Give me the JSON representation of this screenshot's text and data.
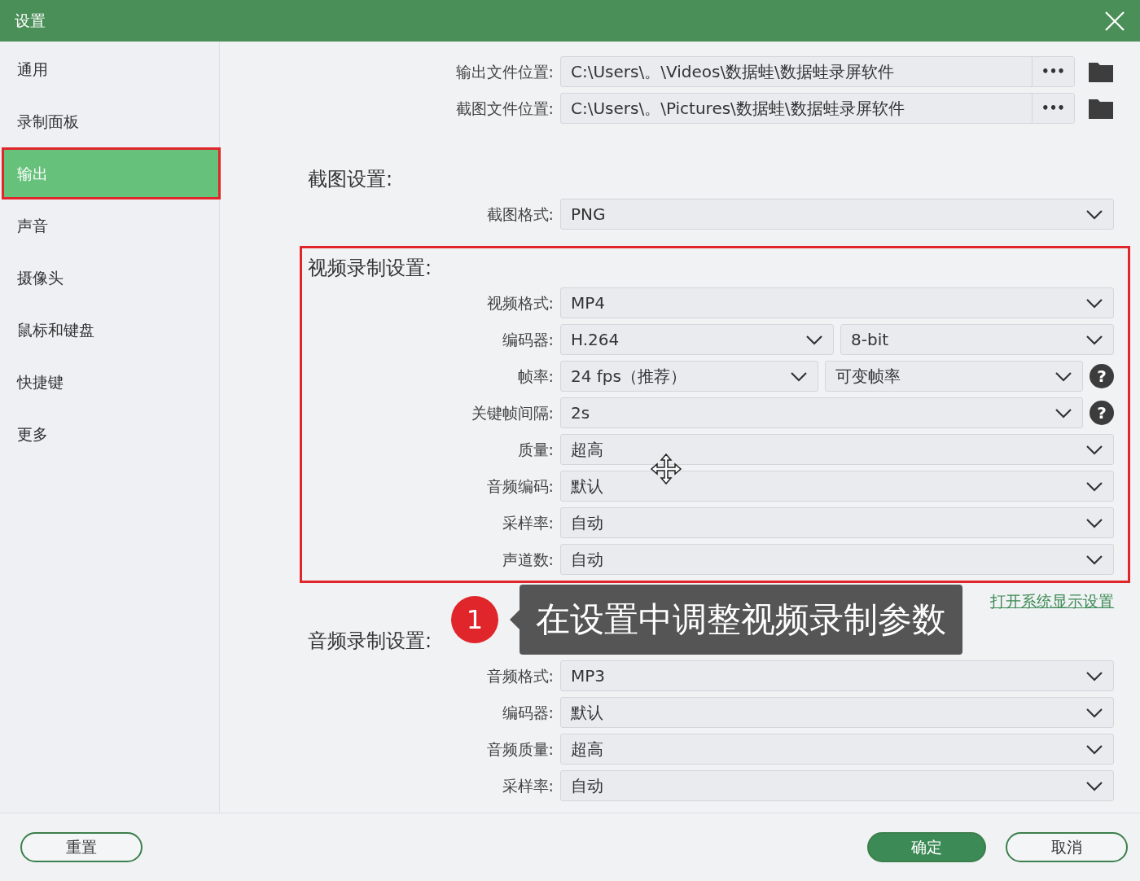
{
  "window": {
    "title": "设置"
  },
  "sidebar": {
    "items": [
      {
        "label": "通用",
        "selected": false,
        "outlined": false
      },
      {
        "label": "录制面板",
        "selected": false,
        "outlined": false
      },
      {
        "label": "输出",
        "selected": true,
        "outlined": true
      },
      {
        "label": "声音",
        "selected": false,
        "outlined": false
      },
      {
        "label": "摄像头",
        "selected": false,
        "outlined": false
      },
      {
        "label": "鼠标和键盘",
        "selected": false,
        "outlined": false
      },
      {
        "label": "快捷键",
        "selected": false,
        "outlined": false
      },
      {
        "label": "更多",
        "selected": false,
        "outlined": false
      }
    ]
  },
  "sections": [
    {
      "outlined": false,
      "rows": [
        {
          "label": "输出文件位置:",
          "controls": [
            {
              "kind": "path",
              "value": "C:\\Users\\。\\Videos\\数据蛙\\数据蛙录屏软件",
              "button": "•••"
            }
          ]
        },
        {
          "label": "截图文件位置:",
          "controls": [
            {
              "kind": "path",
              "value": "C:\\Users\\。\\Pictures\\数据蛙\\数据蛙录屏软件",
              "button": "•••"
            }
          ]
        }
      ]
    },
    {
      "heading": "截图设置:",
      "outlined": false,
      "rows": [
        {
          "label": "截图格式:",
          "controls": [
            {
              "kind": "select",
              "value": "PNG"
            }
          ]
        }
      ]
    },
    {
      "heading": "视频录制设置:",
      "outlined": true,
      "rows": [
        {
          "label": "视频格式:",
          "controls": [
            {
              "kind": "select",
              "value": "MP4"
            }
          ]
        },
        {
          "label": "编码器:",
          "controls": [
            {
              "kind": "select",
              "value": "H.264"
            },
            {
              "kind": "select",
              "value": "8-bit"
            }
          ]
        },
        {
          "label": "帧率:",
          "controls": [
            {
              "kind": "select",
              "value": "24 fps（推荐）"
            },
            {
              "kind": "select",
              "value": "可变帧率"
            }
          ],
          "help": "?"
        },
        {
          "label": "关键帧间隔:",
          "controls": [
            {
              "kind": "select",
              "value": "2s"
            }
          ],
          "help": "?"
        },
        {
          "label": "质量:",
          "controls": [
            {
              "kind": "select",
              "value": "超高"
            }
          ]
        },
        {
          "label": "音频编码:",
          "controls": [
            {
              "kind": "select",
              "value": "默认"
            }
          ]
        },
        {
          "label": "采样率:",
          "controls": [
            {
              "kind": "select",
              "value": "自动"
            }
          ]
        },
        {
          "label": "声道数:",
          "controls": [
            {
              "kind": "select",
              "value": "自动"
            }
          ]
        }
      ],
      "link": "打开系统显示设置"
    },
    {
      "heading": "音频录制设置:",
      "outlined": false,
      "rows": [
        {
          "label": "音频格式:",
          "controls": [
            {
              "kind": "select",
              "value": "MP3"
            }
          ]
        },
        {
          "label": "编码器:",
          "controls": [
            {
              "kind": "select",
              "value": "默认"
            }
          ]
        },
        {
          "label": "音频质量:",
          "controls": [
            {
              "kind": "select",
              "value": "超高"
            }
          ]
        },
        {
          "label": "采样率:",
          "controls": [
            {
              "kind": "select",
              "value": "自动"
            }
          ]
        }
      ]
    }
  ],
  "callout": {
    "number": "1",
    "text": "在设置中调整视频录制参数"
  },
  "footer": {
    "reset": "重置",
    "confirm": "确定",
    "cancel": "取消"
  }
}
